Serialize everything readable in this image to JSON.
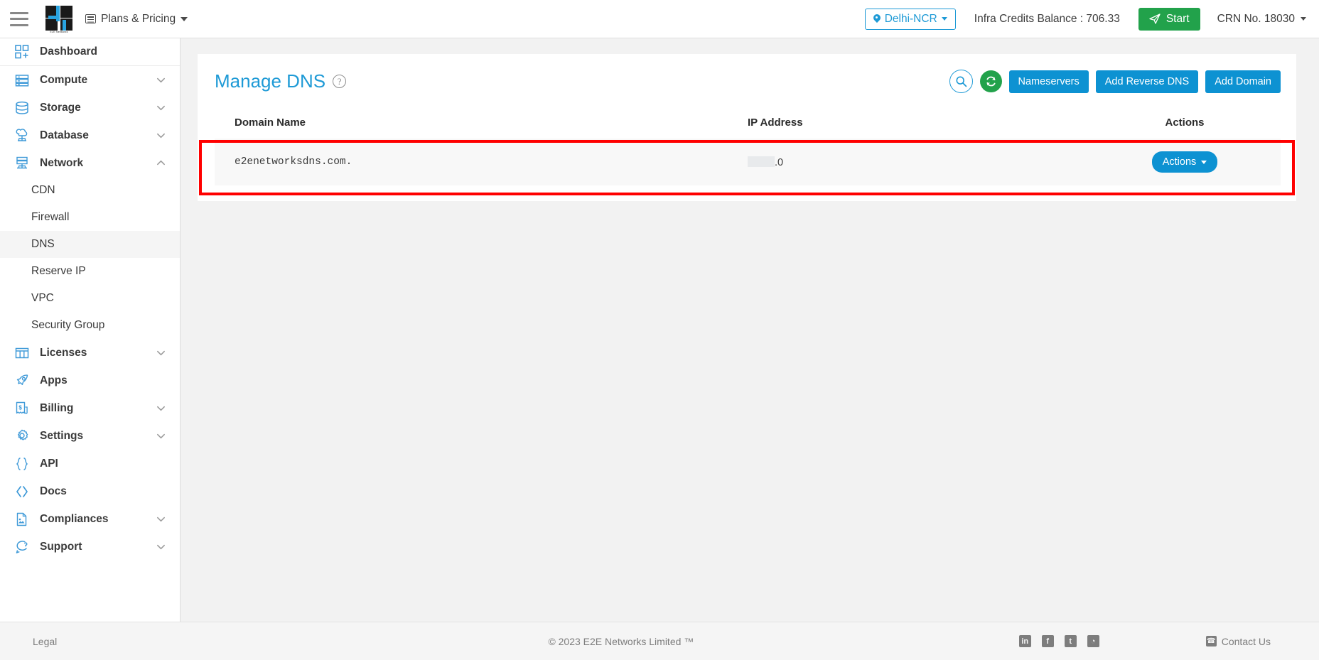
{
  "topbar": {
    "menu_icon": "hamburger-menu-icon",
    "logo_caption": "E2E Networks",
    "plans_label": "Plans & Pricing",
    "region_label": "Delhi-NCR",
    "credits_label": "Infra Credits Balance : 706.33",
    "start_label": "Start",
    "crn_label": "CRN No. 18030"
  },
  "sidebar": {
    "items": [
      {
        "label": "Dashboard",
        "icon": "dashboard-icon",
        "expandable": false
      },
      {
        "label": "Compute",
        "icon": "compute-icon",
        "expandable": true,
        "state": "collapsed"
      },
      {
        "label": "Storage",
        "icon": "storage-icon",
        "expandable": true,
        "state": "collapsed"
      },
      {
        "label": "Database",
        "icon": "database-icon",
        "expandable": true,
        "state": "collapsed"
      },
      {
        "label": "Network",
        "icon": "network-icon",
        "expandable": true,
        "state": "expanded"
      },
      {
        "label": "Licenses",
        "icon": "licenses-icon",
        "expandable": true,
        "state": "collapsed"
      },
      {
        "label": "Apps",
        "icon": "apps-rocket-icon",
        "expandable": false
      },
      {
        "label": "Billing",
        "icon": "billing-invoice-icon",
        "expandable": true,
        "state": "collapsed"
      },
      {
        "label": "Settings",
        "icon": "gear-icon",
        "expandable": true,
        "state": "collapsed"
      },
      {
        "label": "API",
        "icon": "api-braces-icon",
        "expandable": false
      },
      {
        "label": "Docs",
        "icon": "docs-code-icon",
        "expandable": false
      },
      {
        "label": "Compliances",
        "icon": "compliances-document-icon",
        "expandable": true,
        "state": "collapsed"
      },
      {
        "label": "Support",
        "icon": "support-chat-icon",
        "expandable": true,
        "state": "collapsed"
      }
    ],
    "network_subitems": [
      {
        "label": "CDN",
        "active": false
      },
      {
        "label": "Firewall",
        "active": false
      },
      {
        "label": "DNS",
        "active": true
      },
      {
        "label": "Reserve IP",
        "active": false
      },
      {
        "label": "VPC",
        "active": false
      },
      {
        "label": "Security Group",
        "active": false
      }
    ]
  },
  "main": {
    "page_title": "Manage DNS",
    "help_icon": "help-question-icon",
    "toolbar": {
      "search_icon": "search-icon",
      "refresh_icon": "refresh-icon",
      "nameservers_label": "Nameservers",
      "add_reverse_dns_label": "Add Reverse DNS",
      "add_domain_label": "Add Domain"
    },
    "table": {
      "columns": [
        "Domain Name",
        "IP Address",
        "Actions"
      ],
      "rows": [
        {
          "domain_name": "e2enetworksdns.com.",
          "ip_address_redacted": true,
          "ip_address_suffix": ".0",
          "action_label": "Actions"
        }
      ]
    },
    "highlight_color": "#ff0000"
  },
  "footer": {
    "legal_label": "Legal",
    "copyright": "© 2023 E2E Networks Limited ™",
    "social": [
      {
        "name": "linkedin-icon",
        "glyph": "in"
      },
      {
        "name": "facebook-icon",
        "glyph": "f"
      },
      {
        "name": "twitter-icon",
        "glyph": "t"
      },
      {
        "name": "rss-icon",
        "glyph": "◔"
      }
    ],
    "contact_label": "Contact Us",
    "contact_icon": "phone-icon"
  },
  "colors": {
    "accent_blue": "#1e9ad6",
    "button_blue": "#0d92d2",
    "green": "#22a24b",
    "highlight_red": "#ff0000",
    "page_bg": "#f2f2f2"
  }
}
